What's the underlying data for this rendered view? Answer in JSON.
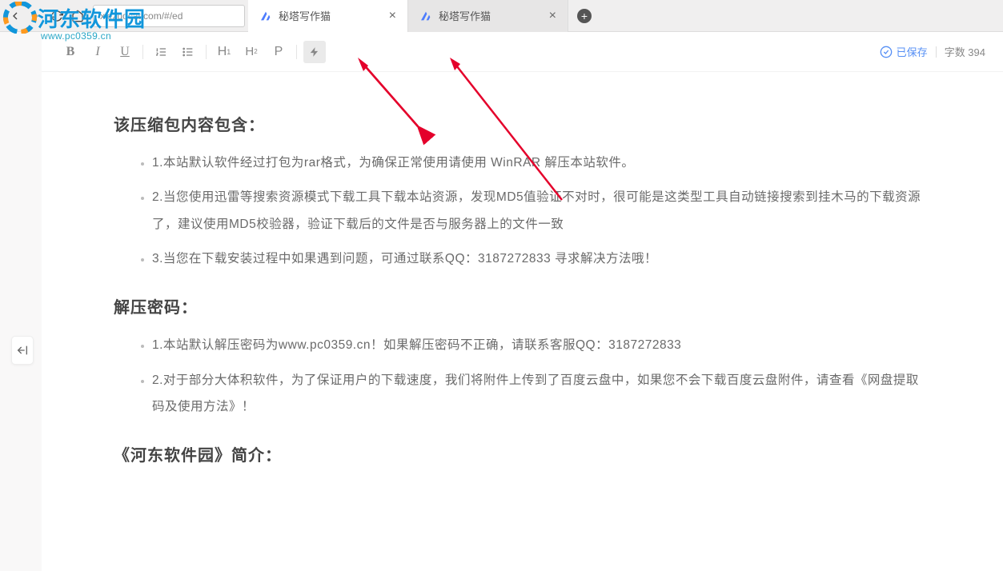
{
  "watermark": {
    "title": "河东软件园",
    "sub": "www.pc0359.cn"
  },
  "browser": {
    "url": "xiezuocat.com/#/ed",
    "tabs": [
      {
        "title": "秘塔写作猫",
        "active": true
      },
      {
        "title": "秘塔写作猫",
        "active": false
      }
    ]
  },
  "status": {
    "saved_label": "已保存",
    "word_count_label": "字数 394"
  },
  "document": {
    "heading1": "该压缩包内容包含：",
    "list1": [
      "1.本站默认软件经过打包为rar格式，为确保正常使用请使用 WinRAR 解压本站软件。",
      "2.当您使用迅雷等搜索资源模式下载工具下载本站资源，发现MD5值验证不对时，很可能是这类型工具自动链接搜索到挂木马的下载资源了，建议使用MD5校验器，验证下载后的文件是否与服务器上的文件一致",
      "3.当您在下载安装过程中如果遇到问题，可通过联系QQ：3187272833 寻求解决方法哦！"
    ],
    "heading2": "解压密码：",
    "list2": [
      "1.本站默认解压密码为www.pc0359.cn！如果解压密码不正确，请联系客服QQ：3187272833",
      "2.对于部分大体积软件，为了保证用户的下载速度，我们将附件上传到了百度云盘中，如果您不会下载百度云盘附件，请查看《网盘提取码及使用方法》！"
    ],
    "heading3": "《河东软件园》简介："
  }
}
